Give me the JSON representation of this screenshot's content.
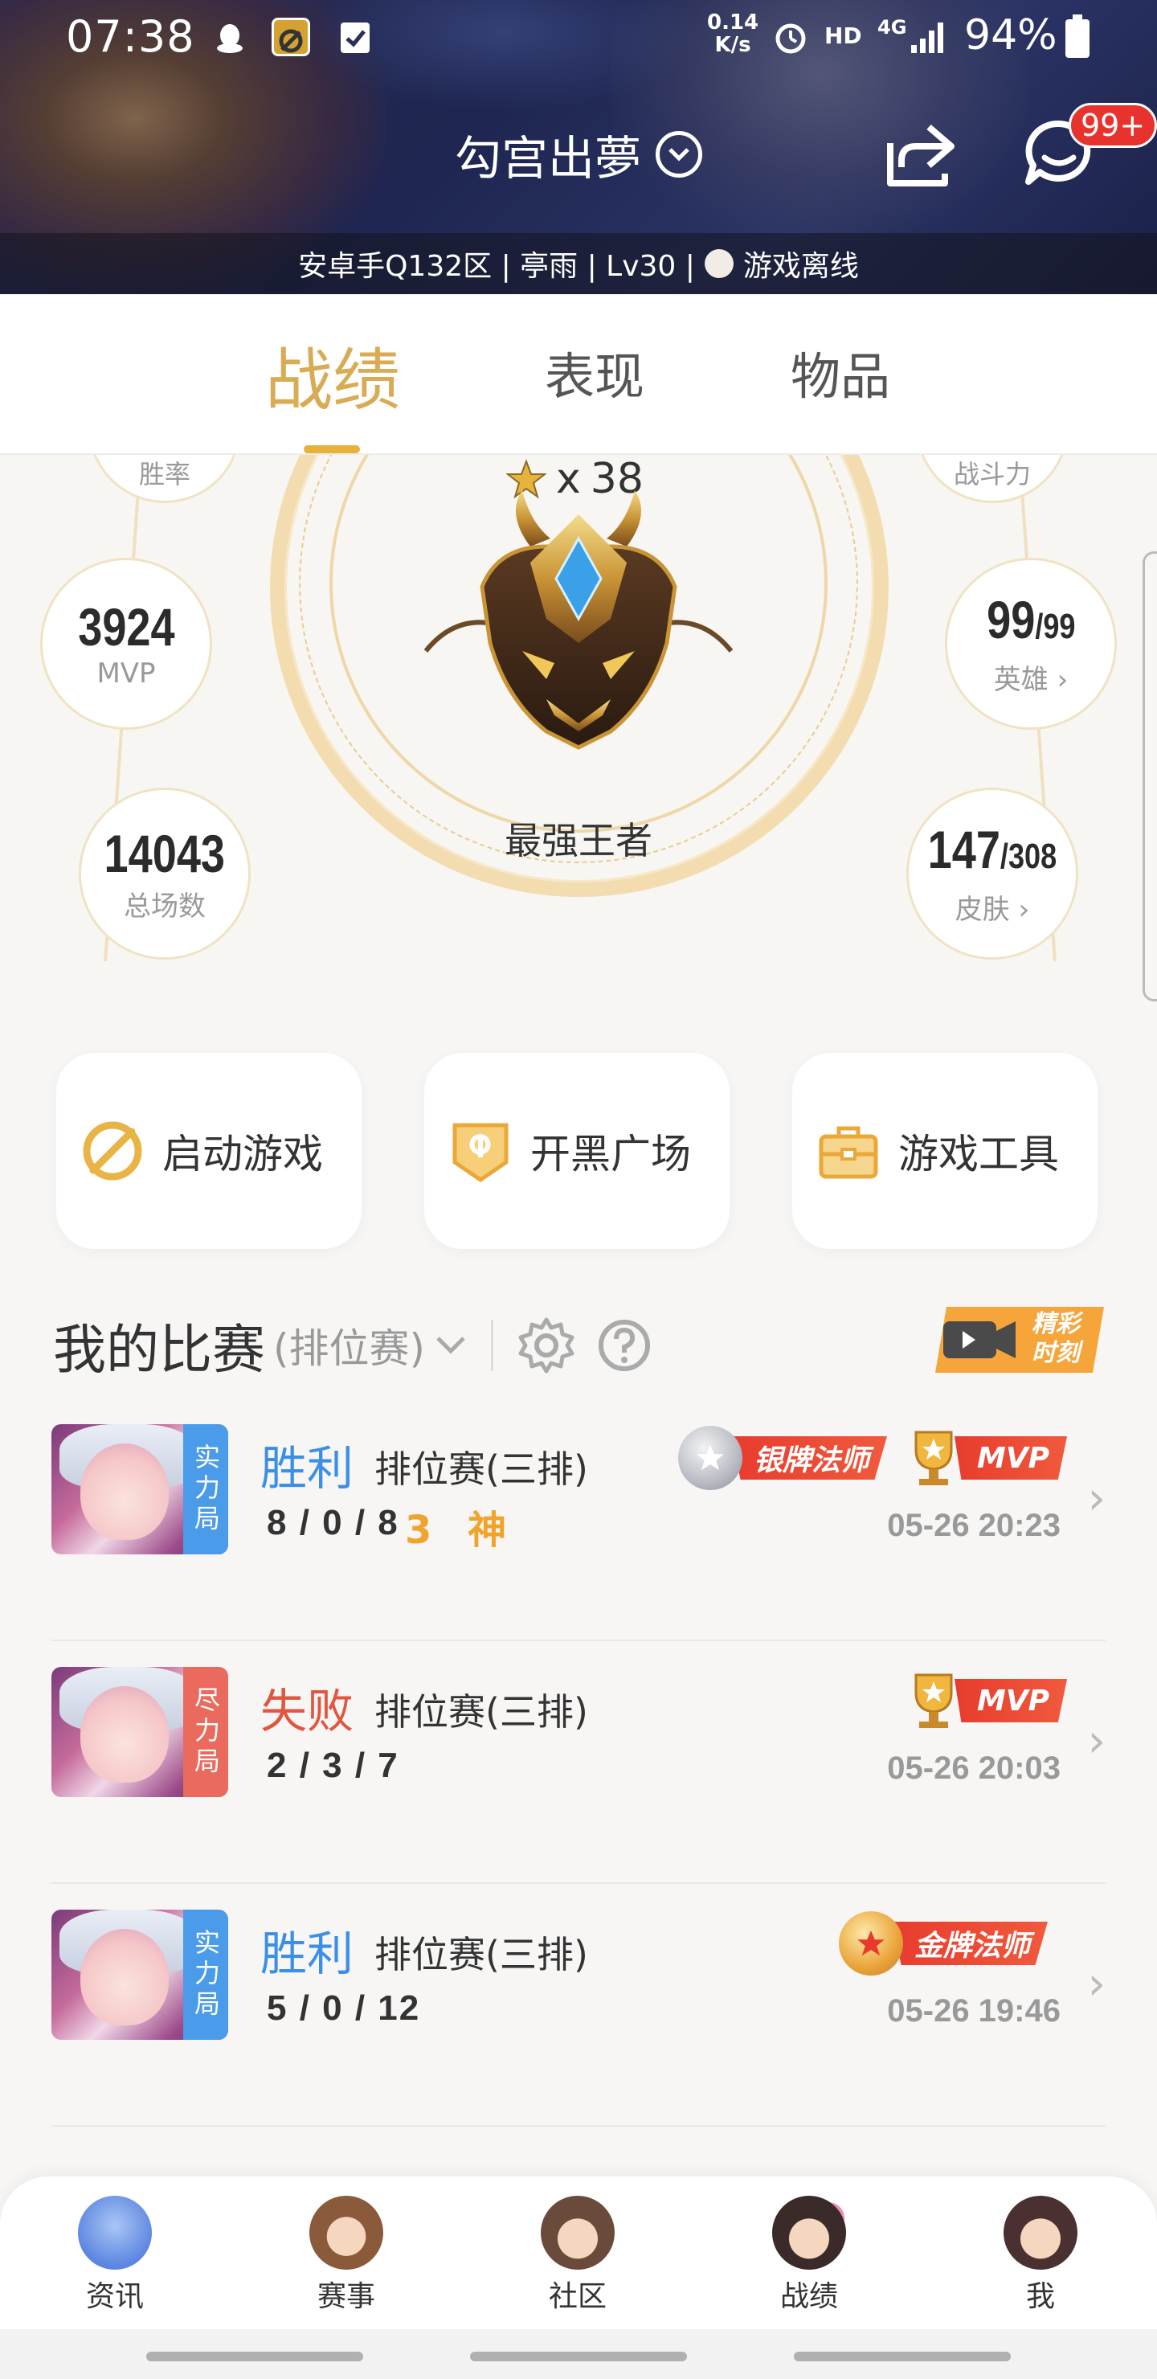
{
  "status_bar": {
    "time": "07:38",
    "net_speed_value": "0.14",
    "net_speed_unit": "K/s",
    "hd": "HD",
    "network": "4G",
    "battery": "94%"
  },
  "header": {
    "profile_name": "勾宫出夢",
    "message_badge": "99+",
    "server_info": "安卓手Q132区 | 亭雨 | Lv30 |",
    "online_status": "游戏离线"
  },
  "tabs": [
    "战绩",
    "表现",
    "物品"
  ],
  "active_tab": "战绩",
  "rank": {
    "star_prefix": "x",
    "stars": "38",
    "name": "最强王者"
  },
  "stats": {
    "top_left_label": "胜率",
    "top_right_label": "战斗力",
    "mvp": {
      "value": "3924",
      "label": "MVP"
    },
    "total": {
      "value": "14043",
      "label": "总场数"
    },
    "heroes": {
      "value": "99",
      "total": "/99",
      "label": "英雄"
    },
    "skins": {
      "value": "147",
      "total": "/308",
      "label": "皮肤"
    }
  },
  "quick_actions": [
    {
      "label": "启动游戏",
      "icon": "launch-game-icon"
    },
    {
      "label": "开黑广场",
      "icon": "team-square-icon"
    },
    {
      "label": "游戏工具",
      "icon": "toolbox-icon"
    }
  ],
  "matches_section": {
    "title": "我的比赛",
    "filter": "(排位赛)",
    "highlight_label": "精彩\n时刻"
  },
  "matches": [
    {
      "tag": "实力局",
      "tag_color": "#4a9bea",
      "result": "胜利",
      "result_type": "win",
      "mode": "排位赛(三排)",
      "kda": "8 / 0 / 8",
      "streak": "3 神",
      "awards": [
        "银牌法师",
        "MVP"
      ],
      "date": "05-26 20:23"
    },
    {
      "tag": "尽力局",
      "tag_color": "#ea6b5e",
      "result": "失败",
      "result_type": "lose",
      "mode": "排位赛(三排)",
      "kda": "2 / 3 / 7",
      "streak": "",
      "awards": [
        "MVP"
      ],
      "date": "05-26 20:03"
    },
    {
      "tag": "实力局",
      "tag_color": "#4a9bea",
      "result": "胜利",
      "result_type": "win",
      "mode": "排位赛(三排)",
      "kda": "5 / 0 / 12",
      "streak": "",
      "awards": [
        "金牌法师"
      ],
      "date": "05-26 19:46"
    }
  ],
  "bottom_nav": [
    {
      "label": "资讯",
      "icon": "news-avatar-icon"
    },
    {
      "label": "赛事",
      "icon": "events-avatar-icon"
    },
    {
      "label": "社区",
      "icon": "community-avatar-icon"
    },
    {
      "label": "战绩",
      "icon": "record-avatar-icon"
    },
    {
      "label": "我",
      "icon": "me-avatar-icon"
    }
  ],
  "colors": {
    "accent_gold": "#d8ab55",
    "win_blue": "#3b8fe6",
    "lose_red": "#e2563f",
    "badge_red": "#e8322e"
  }
}
